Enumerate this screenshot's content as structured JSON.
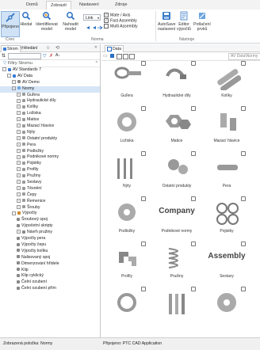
{
  "menu_tabs": [
    "Domů",
    "Zobrazit",
    "Nastavení",
    "Zdroje"
  ],
  "ribbon": {
    "buttons": [
      {
        "label": "Připojeno",
        "icon": "connect-icon"
      },
      {
        "label": "Hledat",
        "icon": "search-icon"
      },
      {
        "label": "Identifikovat model",
        "icon": "identify-model-icon"
      },
      {
        "label": "Nahradit model",
        "icon": "replace-model-icon"
      },
      {
        "label": "AutoSave nastavení",
        "icon": "autosave-icon"
      },
      {
        "label": "Editor výpočtů",
        "icon": "calculation-editor-icon"
      },
      {
        "label": "Potlačení prvků",
        "icon": "suppress-features-icon"
      }
    ],
    "link_combo": "Link",
    "checkboxes": [
      {
        "label": "Mate / Axis",
        "checked": true
      },
      {
        "label": "Fast Assembly",
        "checked": true
      },
      {
        "label": "Multi Assembly",
        "checked": false
      }
    ],
    "groups": [
      "Creo",
      "Norma",
      "Nástroje"
    ]
  },
  "left_panel": {
    "tabs": [
      "Strom",
      "Hledání"
    ],
    "filter_label": "Filtry Stromu",
    "tree": [
      {
        "label": "AV Standards 7",
        "level": 0,
        "color": "#3b7bd4",
        "expand": "-"
      },
      {
        "label": "AV Data",
        "level": 1,
        "color": "#3b7bd4",
        "expand": "-"
      },
      {
        "label": "AV Demo",
        "level": 2,
        "color": "#888888",
        "expand": "+"
      },
      {
        "label": "Normy",
        "level": 2,
        "color": "#6aa5e0",
        "expand": "-",
        "selected": true
      },
      {
        "label": "Guľera",
        "level": 3,
        "color": "#999999",
        "expand": "+"
      },
      {
        "label": "Hydraulické díly",
        "level": 3,
        "color": "#999999",
        "expand": "+"
      },
      {
        "label": "Kolíky",
        "level": 3,
        "color": "#999999",
        "expand": "+"
      },
      {
        "label": "Ložiska",
        "level": 3,
        "color": "#999999",
        "expand": "+"
      },
      {
        "label": "Matice",
        "level": 3,
        "color": "#999999",
        "expand": "+"
      },
      {
        "label": "Mazací hlavice",
        "level": 3,
        "color": "#999999",
        "expand": "+"
      },
      {
        "label": "Nýty",
        "level": 3,
        "color": "#999999",
        "expand": "+"
      },
      {
        "label": "Ostatní produkty",
        "level": 3,
        "color": "#999999",
        "expand": "+"
      },
      {
        "label": "Pera",
        "level": 3,
        "color": "#999999",
        "expand": "+"
      },
      {
        "label": "Podložky",
        "level": 3,
        "color": "#999999",
        "expand": "+"
      },
      {
        "label": "Podnikové normy",
        "level": 3,
        "color": "#999999",
        "expand": "+"
      },
      {
        "label": "Pojistky",
        "level": 3,
        "color": "#999999",
        "expand": "+"
      },
      {
        "label": "Profily",
        "level": 3,
        "color": "#999999",
        "expand": "+"
      },
      {
        "label": "Pružiny",
        "level": 3,
        "color": "#999999",
        "expand": "+"
      },
      {
        "label": "Sestavy",
        "level": 3,
        "color": "#999999",
        "expand": "+"
      },
      {
        "label": "Těsnění",
        "level": 3,
        "color": "#999999",
        "expand": "+"
      },
      {
        "label": "Čepy",
        "level": 3,
        "color": "#999999",
        "expand": "+"
      },
      {
        "label": "Řemenice",
        "level": 3,
        "color": "#999999",
        "expand": "+"
      },
      {
        "label": "Šrouby",
        "level": 3,
        "color": "#999999",
        "expand": "+"
      },
      {
        "label": "Výpočty",
        "level": 2,
        "color": "#c98a2b",
        "expand": "-"
      },
      {
        "label": "Šroubový spoj",
        "level": 3,
        "color": "#888888",
        "expand": ""
      },
      {
        "label": "Výpočetní skripty",
        "level": 3,
        "color": "#888888",
        "expand": ""
      },
      {
        "label": "Návrh pružiny",
        "level": 3,
        "color": "#888888",
        "expand": "+"
      },
      {
        "label": "Výpočty pera",
        "level": 3,
        "color": "#888888",
        "expand": ""
      },
      {
        "label": "Výpočty čepu",
        "level": 3,
        "color": "#888888",
        "expand": ""
      },
      {
        "label": "Výpočty kolíku",
        "level": 3,
        "color": "#888888",
        "expand": ""
      },
      {
        "label": "Nalisovaný spoj",
        "level": 3,
        "color": "#888888",
        "expand": ""
      },
      {
        "label": "Dimenzování hřídele",
        "level": 3,
        "color": "#888888",
        "expand": ""
      },
      {
        "label": "Klip",
        "level": 3,
        "color": "#888888",
        "expand": ""
      },
      {
        "label": "Klip cyklický",
        "level": 3,
        "color": "#888888",
        "expand": ""
      },
      {
        "label": "Čelní ozubení",
        "level": 3,
        "color": "#888888",
        "expand": ""
      },
      {
        "label": "Čelní ozubení přím",
        "level": 3,
        "color": "#888888",
        "expand": ""
      }
    ]
  },
  "main_panel": {
    "tab": "Data",
    "filter_placeholder": "AV Data\\Normy",
    "items": [
      {
        "label": "Guľera",
        "icon": "rod-end-icon"
      },
      {
        "label": "Hydraulické díly",
        "icon": "hydraulic-fitting-icon"
      },
      {
        "label": "Kolíky",
        "icon": "pin-icon"
      },
      {
        "label": "Ložiska",
        "icon": "bearing-icon"
      },
      {
        "label": "Matice",
        "icon": "nut-icon"
      },
      {
        "label": "Mazací hlavice",
        "icon": "grease-nipple-icon"
      },
      {
        "label": "Nýty",
        "icon": "rivet-icon"
      },
      {
        "label": "Ostatní produkty",
        "icon": "other-products-icon"
      },
      {
        "label": "Pera",
        "icon": "key-icon"
      },
      {
        "label": "Podložky",
        "icon": "washer-icon"
      },
      {
        "label": "Podnikové normy",
        "icon": "company-text",
        "text": "Company"
      },
      {
        "label": "Pojistky",
        "icon": "circlip-icon"
      },
      {
        "label": "Profily",
        "icon": "profile-icon"
      },
      {
        "label": "Pružiny",
        "icon": "spring-icon"
      },
      {
        "label": "Sestavy",
        "icon": "assembly-text",
        "text": "Assembly"
      },
      {
        "label": "",
        "icon": "o-ring-icon"
      },
      {
        "label": "",
        "icon": "pin-bolt-icon"
      },
      {
        "label": "",
        "icon": "pulley-icon"
      }
    ]
  },
  "status": {
    "left": "Zobrazená položka: Normy",
    "right": "Připojeno: PTC CAD Application"
  }
}
